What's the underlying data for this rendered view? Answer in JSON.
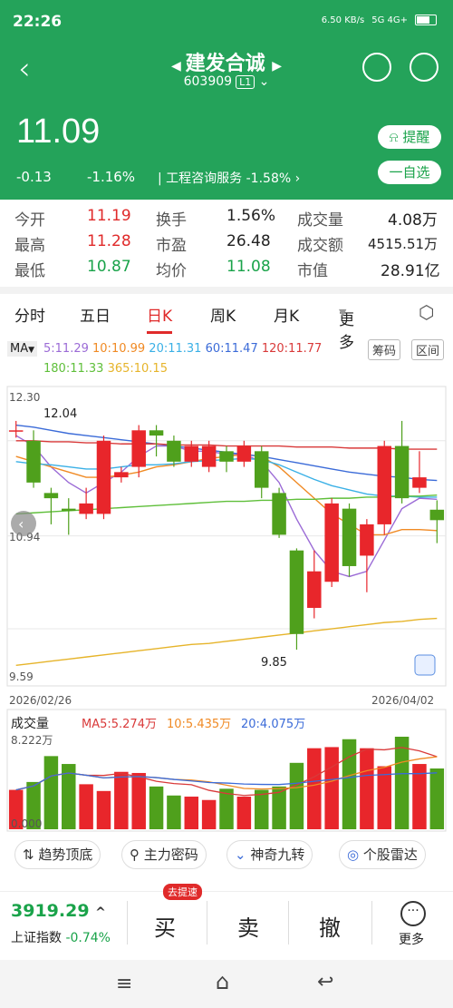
{
  "status": {
    "time": "22:26",
    "net_speed": "6.50 KB/s",
    "signal": "5G  4G+"
  },
  "header": {
    "title": "建发合诚",
    "code": "603909",
    "level": "L1",
    "price": "11.09",
    "change": "-0.13",
    "change_pct": "-1.16%",
    "sector": "工程咨询服务 -1.58%",
    "alert_btn": "提醒",
    "watch_btn": "一自选"
  },
  "stats": [
    {
      "l1": "今开",
      "v1": "11.19",
      "l2": "换手",
      "v2": "1.56%",
      "l3": "成交量",
      "v3": "4.08万"
    },
    {
      "l1": "最高",
      "v1": "11.28",
      "l2": "市盈",
      "v2": "26.48",
      "l3": "成交额",
      "v3": "4515.51万"
    },
    {
      "l1": "最低",
      "v1": "10.87",
      "l2": "均价",
      "v2": "11.08",
      "l3": "市值",
      "v3": "28.91亿"
    }
  ],
  "tabs": [
    "分时",
    "五日",
    "日K",
    "周K",
    "月K",
    "更多"
  ],
  "ma": {
    "label": "MA",
    "ma5": "5:11.29",
    "ma10": "10:10.99",
    "ma20": "20:11.31",
    "ma60": "60:11.47",
    "ma120": "120:11.77",
    "ma180": "180:11.33",
    "ma365": "365:10.15",
    "btn1": "筹码",
    "btn2": "区间"
  },
  "chart_data": {
    "type": "candlestick",
    "y_top": "12.30",
    "y_mid": "10.94",
    "y_bottom": "9.59",
    "high_label": "12.04",
    "low_label": "9.85",
    "date_start": "2026/02/26",
    "date_end": "2026/04/02",
    "ylim": [
      9.59,
      12.3
    ],
    "candles": [
      {
        "o": 11.95,
        "c": 11.95,
        "h": 12.04,
        "l": 11.88
      },
      {
        "o": 11.85,
        "c": 11.45,
        "h": 11.95,
        "l": 11.4
      },
      {
        "o": 11.35,
        "c": 11.3,
        "h": 11.4,
        "l": 11.05
      },
      {
        "o": 11.2,
        "c": 11.18,
        "h": 11.3,
        "l": 10.95
      },
      {
        "o": 11.15,
        "c": 11.25,
        "h": 11.4,
        "l": 11.1
      },
      {
        "o": 11.15,
        "c": 11.85,
        "h": 11.9,
        "l": 11.1
      },
      {
        "o": 11.5,
        "c": 11.55,
        "h": 11.6,
        "l": 11.45
      },
      {
        "o": 11.6,
        "c": 11.95,
        "h": 12.0,
        "l": 11.5
      },
      {
        "o": 11.95,
        "c": 11.9,
        "h": 12.0,
        "l": 11.7
      },
      {
        "o": 11.85,
        "c": 11.65,
        "h": 11.9,
        "l": 11.6
      },
      {
        "o": 11.65,
        "c": 11.8,
        "h": 11.85,
        "l": 11.6
      },
      {
        "o": 11.6,
        "c": 11.8,
        "h": 11.85,
        "l": 11.55
      },
      {
        "o": 11.75,
        "c": 11.65,
        "h": 11.8,
        "l": 11.55
      },
      {
        "o": 11.65,
        "c": 11.8,
        "h": 11.85,
        "l": 11.6
      },
      {
        "o": 11.75,
        "c": 11.4,
        "h": 11.8,
        "l": 11.3
      },
      {
        "o": 11.35,
        "c": 10.95,
        "h": 11.4,
        "l": 10.92
      },
      {
        "o": 10.8,
        "c": 10.0,
        "h": 10.82,
        "l": 9.85
      },
      {
        "o": 10.25,
        "c": 10.6,
        "h": 10.8,
        "l": 10.15
      },
      {
        "o": 10.5,
        "c": 11.25,
        "h": 11.3,
        "l": 10.45
      },
      {
        "o": 11.2,
        "c": 10.65,
        "h": 11.25,
        "l": 10.55
      },
      {
        "o": 10.75,
        "c": 11.05,
        "h": 11.1,
        "l": 10.4
      },
      {
        "o": 11.05,
        "c": 11.8,
        "h": 11.85,
        "l": 10.95
      },
      {
        "o": 11.8,
        "c": 11.3,
        "h": 12.04,
        "l": 11.25
      },
      {
        "o": 11.4,
        "c": 11.5,
        "h": 11.75,
        "l": 11.35
      },
      {
        "o": 11.19,
        "c": 11.09,
        "h": 11.28,
        "l": 10.87
      }
    ],
    "ma_series": [
      {
        "name": "MA5",
        "color": "#9b6bd6",
        "values": [
          11.9,
          11.8,
          11.6,
          11.45,
          11.35,
          11.45,
          11.55,
          11.7,
          11.8,
          11.8,
          11.75,
          11.75,
          11.72,
          11.72,
          11.65,
          11.45,
          11.1,
          10.8,
          10.6,
          10.55,
          10.6,
          10.9,
          11.2,
          11.3,
          11.29
        ]
      },
      {
        "name": "MA10",
        "color": "#f08a24",
        "values": [
          11.7,
          11.65,
          11.6,
          11.55,
          11.5,
          11.5,
          11.52,
          11.55,
          11.6,
          11.62,
          11.65,
          11.68,
          11.7,
          11.72,
          11.7,
          11.6,
          11.45,
          11.3,
          11.15,
          11.05,
          10.95,
          10.95,
          11.0,
          11.0,
          10.99
        ]
      },
      {
        "name": "MA20",
        "color": "#3ab0e6",
        "values": [
          11.65,
          11.63,
          11.62,
          11.6,
          11.58,
          11.58,
          11.6,
          11.62,
          11.62,
          11.63,
          11.65,
          11.66,
          11.67,
          11.68,
          11.67,
          11.62,
          11.55,
          11.48,
          11.42,
          11.38,
          11.34,
          11.32,
          11.32,
          11.31,
          11.31
        ]
      },
      {
        "name": "MA60",
        "color": "#3b6bd8",
        "values": [
          12.0,
          11.98,
          11.95,
          11.92,
          11.9,
          11.88,
          11.86,
          11.84,
          11.82,
          11.8,
          11.78,
          11.76,
          11.74,
          11.72,
          11.7,
          11.67,
          11.64,
          11.61,
          11.58,
          11.55,
          11.53,
          11.51,
          11.5,
          11.48,
          11.47
        ]
      },
      {
        "name": "MA120",
        "color": "#d93a3a",
        "values": [
          11.85,
          11.85,
          11.84,
          11.84,
          11.83,
          11.83,
          11.82,
          11.82,
          11.82,
          11.81,
          11.81,
          11.81,
          11.8,
          11.8,
          11.8,
          11.8,
          11.79,
          11.79,
          11.79,
          11.78,
          11.78,
          11.78,
          11.77,
          11.77,
          11.77
        ]
      },
      {
        "name": "MA180",
        "color": "#5fbf3a",
        "values": [
          11.15,
          11.16,
          11.17,
          11.18,
          11.19,
          11.2,
          11.21,
          11.22,
          11.23,
          11.24,
          11.25,
          11.26,
          11.27,
          11.27,
          11.28,
          11.28,
          11.29,
          11.29,
          11.3,
          11.3,
          11.31,
          11.31,
          11.32,
          11.32,
          11.33
        ]
      },
      {
        "name": "MA365",
        "color": "#e6b42a",
        "values": [
          9.7,
          9.72,
          9.74,
          9.76,
          9.78,
          9.8,
          9.82,
          9.84,
          9.86,
          9.88,
          9.9,
          9.91,
          9.93,
          9.95,
          9.97,
          9.99,
          10.01,
          10.03,
          10.05,
          10.07,
          10.09,
          10.11,
          10.12,
          10.14,
          10.15
        ]
      }
    ],
    "volume": {
      "label": "成交量",
      "ma5": "MA5:5.274万",
      "ma10": "10:5.435万",
      "ma20": "20:4.075万",
      "max_label": "8.222万",
      "zero_label": "0.000",
      "values": [
        3.5,
        4.2,
        6.5,
        5.8,
        4.0,
        3.4,
        5.1,
        5.0,
        3.8,
        3.0,
        2.9,
        2.6,
        3.6,
        2.9,
        3.5,
        3.8,
        5.9,
        7.2,
        7.3,
        8.0,
        7.2,
        5.6,
        8.222,
        5.8,
        5.4
      ]
    }
  },
  "tools": [
    "趋势顶底",
    "主力密码",
    "神奇九转",
    "个股雷达"
  ],
  "bottom": {
    "index_value": "3919.29",
    "index_name": "上证指数",
    "index_pct": "-0.74%",
    "badge": "去提速",
    "buy": "买",
    "sell": "卖",
    "cancel": "撤",
    "more": "更多"
  }
}
